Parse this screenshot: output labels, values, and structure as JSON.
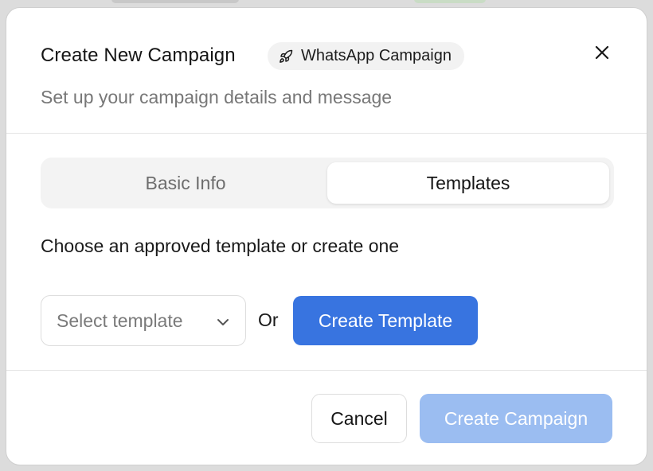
{
  "dialog": {
    "title": "Create New Campaign",
    "badge": {
      "icon": "rocket-icon",
      "label": "WhatsApp Campaign"
    },
    "subtitle": "Set up your campaign details and message",
    "close_icon": "close-icon"
  },
  "tabs": [
    {
      "label": "Basic Info",
      "active": false
    },
    {
      "label": "Templates",
      "active": true
    }
  ],
  "templates_section": {
    "instruction": "Choose an approved template or create one",
    "select": {
      "placeholder": "Select template",
      "icon": "chevron-down-icon"
    },
    "or_text": "Or",
    "create_template_label": "Create Template"
  },
  "footer": {
    "cancel_label": "Cancel",
    "create_campaign_label": "Create Campaign",
    "create_campaign_disabled": true
  },
  "colors": {
    "primary": "#3874e0",
    "primary_disabled": "#9bbdf1",
    "muted_text": "#777777",
    "tab_track": "#f3f3f3"
  }
}
